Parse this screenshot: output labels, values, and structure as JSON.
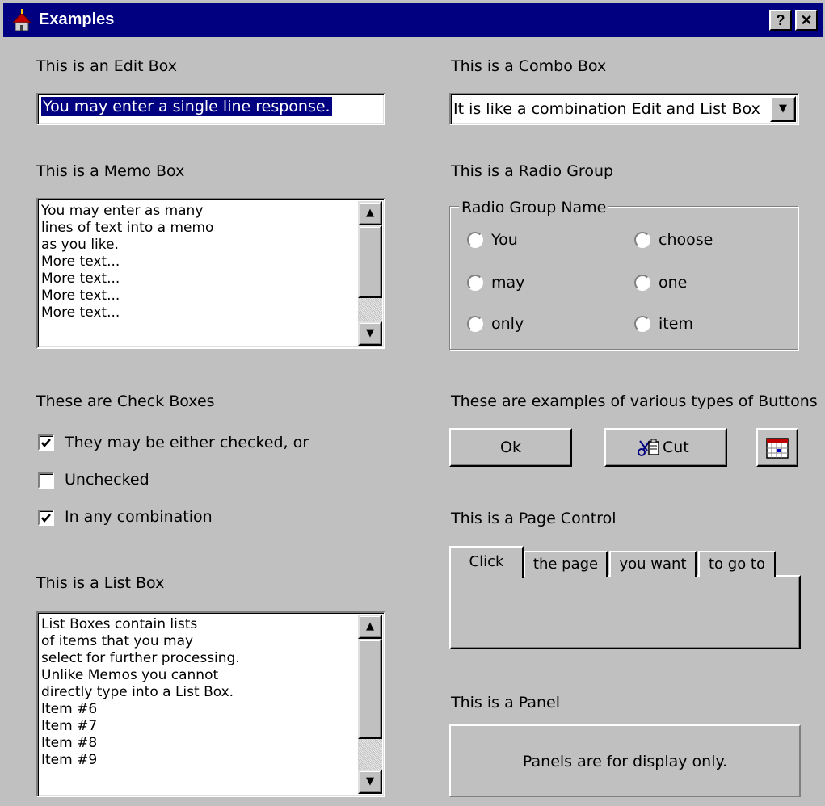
{
  "window": {
    "title": "Examples",
    "help_glyph": "?",
    "close_glyph": "✕",
    "icon": "house-app-icon"
  },
  "edit_section": {
    "label": "This is an Edit Box",
    "value": "You may enter a single line response."
  },
  "combo_section": {
    "label": "This is a Combo Box",
    "value": "It is like a combination Edit and List Box",
    "arrow_glyph": "▼"
  },
  "memo_section": {
    "label": "This is a Memo Box",
    "lines": [
      "You may enter as many",
      "lines of text into a memo",
      "as you like.",
      "More text...",
      "More text...",
      "More text...",
      "More text..."
    ]
  },
  "radio_section": {
    "label": "This is a Radio Group",
    "group_name": "Radio Group Name",
    "options": [
      "You",
      "choose",
      "may",
      "one",
      "only",
      "item"
    ]
  },
  "check_section": {
    "label": "These are Check Boxes",
    "items": [
      {
        "label": "They may be either checked, or",
        "checked": true
      },
      {
        "label": "Unchecked",
        "checked": false
      },
      {
        "label": "In any combination",
        "checked": true
      }
    ]
  },
  "button_section": {
    "label": "These are examples of various types of Buttons",
    "ok_label": "Ok",
    "cut_label": "Cut",
    "cut_icon": "scissors-clipboard-icon",
    "calendar_icon": "calendar-icon"
  },
  "page_control_section": {
    "label": "This is a Page Control",
    "tabs": [
      "Click",
      "the page",
      "you want",
      "to go to"
    ],
    "active_tab": "Click"
  },
  "list_section": {
    "label": "This is a List Box",
    "items": [
      "List Boxes contain lists",
      "of items that you may",
      "select for further processing.",
      "Unlike Memos you cannot",
      "directly type into a List Box.",
      "Item #6",
      "Item #7",
      "Item #8",
      "Item #9"
    ]
  },
  "panel_section": {
    "label": "This is a Panel",
    "text": "Panels are for display only."
  },
  "scroll_glyphs": {
    "up": "▲",
    "down": "▼"
  },
  "colors": {
    "face": "#c0c0c0",
    "title_bar": "#000080",
    "selection": "#000080"
  }
}
